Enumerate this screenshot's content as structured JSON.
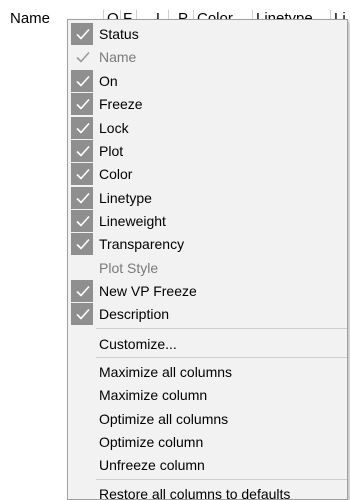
{
  "header": {
    "name": "Name",
    "col_on": "O",
    "col_freeze": "F",
    "col_lock": "L",
    "col_plot": "P",
    "col_color": "Color",
    "col_linetype": "Linetype",
    "col_extra": "Li"
  },
  "menu": {
    "columns": [
      {
        "label": "Status",
        "checked": true,
        "enabled": true
      },
      {
        "label": "Name",
        "checked": true,
        "enabled": false
      },
      {
        "label": "On",
        "checked": true,
        "enabled": true
      },
      {
        "label": "Freeze",
        "checked": true,
        "enabled": true
      },
      {
        "label": "Lock",
        "checked": true,
        "enabled": true
      },
      {
        "label": "Plot",
        "checked": true,
        "enabled": true
      },
      {
        "label": "Color",
        "checked": true,
        "enabled": true
      },
      {
        "label": "Linetype",
        "checked": true,
        "enabled": true
      },
      {
        "label": "Lineweight",
        "checked": true,
        "enabled": true
      },
      {
        "label": "Transparency",
        "checked": true,
        "enabled": true
      },
      {
        "label": "Plot Style",
        "checked": false,
        "enabled": false
      },
      {
        "label": "New VP Freeze",
        "checked": true,
        "enabled": true
      },
      {
        "label": "Description",
        "checked": true,
        "enabled": true
      }
    ],
    "customize": "Customize...",
    "actions": [
      "Maximize all columns",
      "Maximize column",
      "Optimize all columns",
      "Optimize column",
      "Unfreeze column"
    ],
    "restore": "Restore all columns to defaults"
  },
  "colors": {
    "menu_bg": "#f2f2f2",
    "check_bg": "#8f8f8f",
    "check_mark": "#ffffff",
    "disabled_text": "#7a7a7a"
  }
}
